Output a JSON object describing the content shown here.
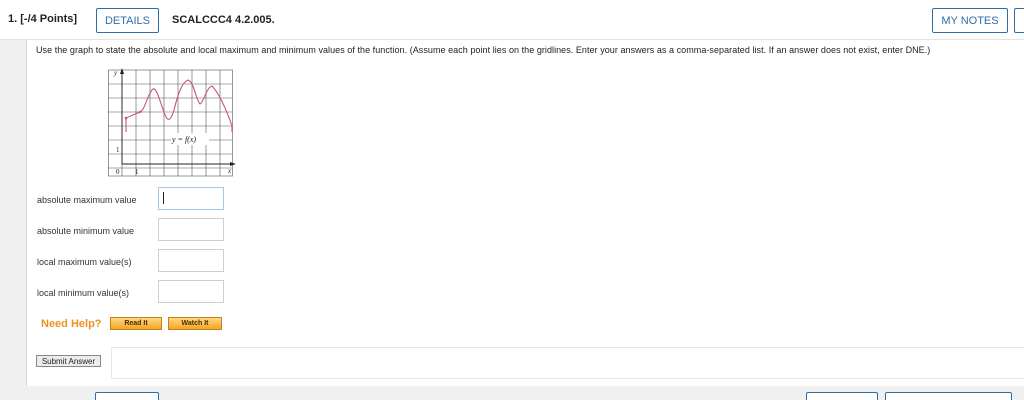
{
  "header": {
    "question_number": "1.",
    "points": "[-/4 Points]",
    "details_label": "DETAILS",
    "question_code": "SCALCCC4 4.2.005.",
    "my_notes_label": "MY NOTES"
  },
  "question": {
    "prompt": "Use the graph to state the absolute and local maximum and minimum values of the function. (Assume each point lies on the gridlines. Enter your answers as a comma-separated list. If an answer does not exist, enter DNE.)"
  },
  "graph": {
    "y_axis_label": "y",
    "x_axis_label": "x",
    "function_label": "y = f(x)",
    "tick_y": "1",
    "tick_x": "1",
    "origin_label": "0",
    "curve_color": "#c9508a",
    "grid_color": "#444444"
  },
  "fields": [
    {
      "label": "absolute maximum value",
      "value": ""
    },
    {
      "label": "absolute minimum value",
      "value": ""
    },
    {
      "label": "local maximum value(s)",
      "value": ""
    },
    {
      "label": "local minimum value(s)",
      "value": ""
    }
  ],
  "help": {
    "need_help_label": "Need Help?",
    "read_it_label": "Read It",
    "watch_it_label": "Watch It"
  },
  "submit": {
    "submit_label": "Submit Answer"
  }
}
